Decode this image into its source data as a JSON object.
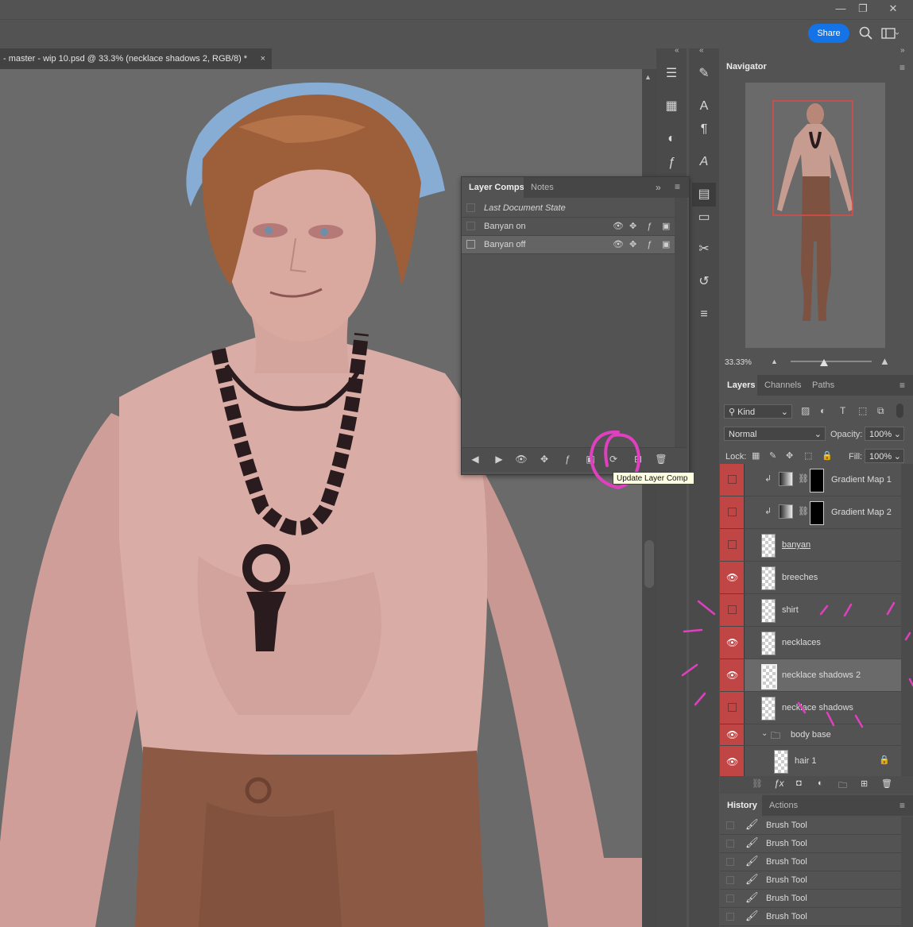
{
  "window": {
    "share_label": "Share"
  },
  "document": {
    "tab_title": "- master - wip 10.psd @ 33.3% (necklace shadows 2, RGB/8) *",
    "close_glyph": "×"
  },
  "layer_comps": {
    "tabs": [
      "Layer Comps",
      "Notes"
    ],
    "rows": [
      {
        "name": "Last Document State"
      },
      {
        "name": "Banyan on"
      },
      {
        "name": "Banyan off"
      }
    ],
    "tooltip": "Update Layer Comp"
  },
  "navigator": {
    "title": "Navigator",
    "zoom": "33.33%"
  },
  "layers": {
    "tabs": [
      "Layers",
      "Channels",
      "Paths"
    ],
    "filter": "Kind",
    "blend_mode": "Normal",
    "opacity_label": "Opacity:",
    "opacity": "100%",
    "lock_label": "Lock:",
    "fill_label": "Fill:",
    "fill": "100%",
    "items": [
      {
        "name": "Gradient Map 1",
        "visible": false
      },
      {
        "name": "Gradient Map 2",
        "visible": false
      },
      {
        "name": "banyan",
        "visible": false
      },
      {
        "name": "breeches",
        "visible": true
      },
      {
        "name": "shirt",
        "visible": false
      },
      {
        "name": "necklaces",
        "visible": true
      },
      {
        "name": "necklace shadows 2",
        "visible": true
      },
      {
        "name": "necklace shadows",
        "visible": false
      },
      {
        "name": "body base",
        "visible": true
      },
      {
        "name": "hair 1",
        "visible": true
      }
    ]
  },
  "history": {
    "tabs": [
      "History",
      "Actions"
    ],
    "items": [
      "Brush Tool",
      "Brush Tool",
      "Brush Tool",
      "Brush Tool",
      "Brush Tool",
      "Brush Tool"
    ]
  },
  "colors": {
    "accent": "#1473e6",
    "visibility": "#c04545",
    "annotation": "#e040c0"
  }
}
